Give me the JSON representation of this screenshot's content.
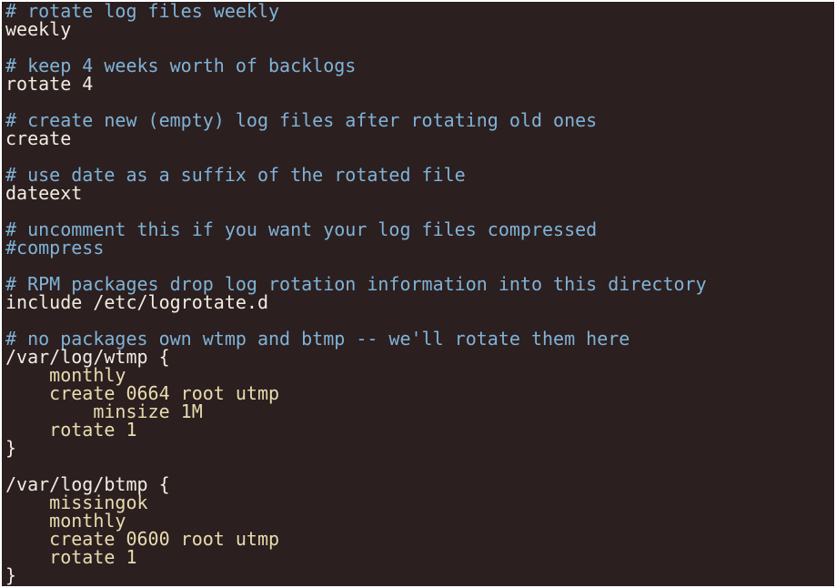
{
  "editor": {
    "lines": [
      {
        "text": "# rotate log files weekly",
        "kind": "comment"
      },
      {
        "text": "weekly",
        "kind": "code"
      },
      {
        "text": "",
        "kind": "blank"
      },
      {
        "text": "# keep 4 weeks worth of backlogs",
        "kind": "comment"
      },
      {
        "text": "rotate 4",
        "kind": "code"
      },
      {
        "text": "",
        "kind": "blank"
      },
      {
        "text": "# create new (empty) log files after rotating old ones",
        "kind": "comment"
      },
      {
        "text": "create",
        "kind": "code"
      },
      {
        "text": "",
        "kind": "blank"
      },
      {
        "text": "# use date as a suffix of the rotated file",
        "kind": "comment"
      },
      {
        "text": "dateext",
        "kind": "code"
      },
      {
        "text": "",
        "kind": "blank"
      },
      {
        "text": "# uncomment this if you want your log files compressed",
        "kind": "comment"
      },
      {
        "text": "#compress",
        "kind": "comment"
      },
      {
        "text": "",
        "kind": "blank"
      },
      {
        "text": "# RPM packages drop log rotation information into this directory",
        "kind": "comment"
      },
      {
        "text": "include /etc/logrotate.d",
        "kind": "code"
      },
      {
        "text": "",
        "kind": "blank"
      },
      {
        "text": "# no packages own wtmp and btmp -- we'll rotate them here",
        "kind": "comment"
      },
      {
        "text": "/var/log/wtmp {",
        "kind": "code"
      },
      {
        "text": "    monthly",
        "kind": "indented"
      },
      {
        "text": "    create 0664 root utmp",
        "kind": "indented"
      },
      {
        "text": "        minsize 1M",
        "kind": "indented"
      },
      {
        "text": "    rotate 1",
        "kind": "indented"
      },
      {
        "text": "}",
        "kind": "code"
      },
      {
        "text": "",
        "kind": "blank"
      },
      {
        "text": "/var/log/btmp {",
        "kind": "code"
      },
      {
        "text": "    missingok",
        "kind": "indented"
      },
      {
        "text": "    monthly",
        "kind": "indented"
      },
      {
        "text": "    create 0600 root utmp",
        "kind": "indented"
      },
      {
        "text": "    rotate 1",
        "kind": "indented"
      },
      {
        "text": "}",
        "kind": "code"
      }
    ]
  },
  "colors": {
    "background": "#2c1f1f",
    "comment": "#7fb3d8",
    "code": "#f0ede2",
    "indented": "#e8dcb0"
  }
}
